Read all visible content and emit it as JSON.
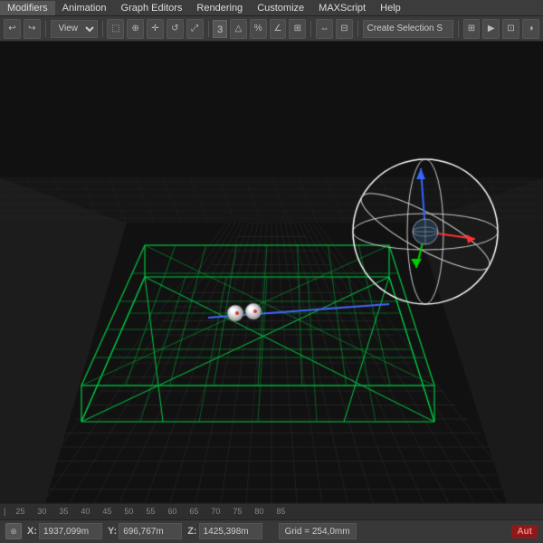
{
  "menubar": {
    "items": [
      "Modifiers",
      "Animation",
      "Graph Editors",
      "Rendering",
      "Customize",
      "MAXScript",
      "Help"
    ]
  },
  "toolbar": {
    "view_label": "View",
    "number": "3",
    "create_selection": "Create Selection S",
    "buttons": [
      "undo",
      "redo",
      "select",
      "move",
      "rotate",
      "scale",
      "snap",
      "mirror",
      "array",
      "align"
    ]
  },
  "ruler": {
    "ticks": [
      "25",
      "30",
      "35",
      "40",
      "45",
      "50",
      "55",
      "60",
      "65",
      "70",
      "75",
      "80",
      "85"
    ]
  },
  "coords": {
    "x_label": "X:",
    "x_value": "1937,099m",
    "y_label": "Y:",
    "y_value": "696,767m",
    "z_label": "Z:",
    "z_value": "1425,398m",
    "grid_label": "Grid = 254,0mm",
    "auto_label": "Aut"
  }
}
